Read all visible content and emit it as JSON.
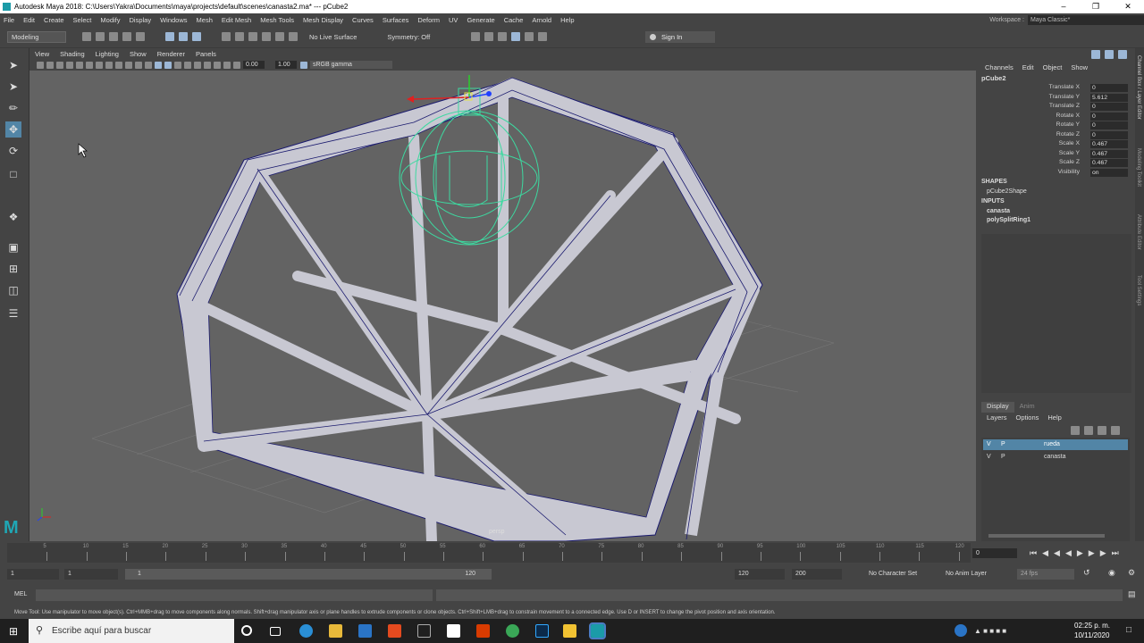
{
  "window": {
    "title": "Autodesk Maya 2018: C:\\Users\\Yakra\\Documents\\maya\\projects\\default\\scenes\\canasta2.ma*   ---   pCube2",
    "workspace_label": "Workspace :",
    "workspace_value": "Maya Classic*"
  },
  "menu": [
    "File",
    "Edit",
    "Create",
    "Select",
    "Modify",
    "Display",
    "Windows",
    "Mesh",
    "Edit Mesh",
    "Mesh Tools",
    "Mesh Display",
    "Curves",
    "Surfaces",
    "Deform",
    "UV",
    "Generate",
    "Cache",
    "Arnold",
    "Help"
  ],
  "shelf": {
    "mode": "Modeling",
    "live_surface": "No Live Surface",
    "symmetry": "Symmetry: Off",
    "sign_in": "Sign In"
  },
  "viewport": {
    "menu": [
      "View",
      "Shading",
      "Lighting",
      "Show",
      "Renderer",
      "Panels"
    ],
    "exposure": "0.00",
    "gamma": "1.00",
    "colorspace": "sRGB gamma",
    "camera_label": "persp"
  },
  "channel_box": {
    "tabs": [
      "Channels",
      "Edit",
      "Object",
      "Show"
    ],
    "object": "pCube2",
    "attributes": [
      {
        "label": "Translate X",
        "value": "0"
      },
      {
        "label": "Translate Y",
        "value": "5.612"
      },
      {
        "label": "Translate Z",
        "value": "0"
      },
      {
        "label": "Rotate X",
        "value": "0"
      },
      {
        "label": "Rotate Y",
        "value": "0"
      },
      {
        "label": "Rotate Z",
        "value": "0"
      },
      {
        "label": "Scale X",
        "value": "0.467"
      },
      {
        "label": "Scale Y",
        "value": "0.467"
      },
      {
        "label": "Scale Z",
        "value": "0.467"
      },
      {
        "label": "Visibility",
        "value": "on"
      }
    ],
    "shapes_header": "SHAPES",
    "shape": "pCube2Shape",
    "inputs_header": "INPUTS",
    "inputs": [
      "canasta",
      "polySplitRing1"
    ]
  },
  "layer_editor": {
    "tabs": [
      "Display",
      "Anim"
    ],
    "menu": [
      "Layers",
      "Options",
      "Help"
    ],
    "layers": [
      {
        "v": "V",
        "p": "P",
        "name": "rueda",
        "selected": true
      },
      {
        "v": "V",
        "p": "P",
        "name": "canasta",
        "selected": false
      }
    ]
  },
  "side_tabs": [
    "Channel Box / Layer Editor",
    "Modeling Toolkit",
    "Attribute Editor",
    "Tool Settings"
  ],
  "timeline": {
    "ticks": [
      "5",
      "10",
      "15",
      "20",
      "25",
      "30",
      "35",
      "40",
      "45",
      "50",
      "55",
      "60",
      "65",
      "70",
      "75",
      "80",
      "85",
      "90",
      "95",
      "100",
      "105",
      "110",
      "115",
      "120"
    ],
    "current_frame": "0"
  },
  "range": {
    "start": "1",
    "start2": "1",
    "slider_start": "1",
    "slider_end": "120",
    "end": "120",
    "end2": "200",
    "char_set": "No Character Set",
    "anim_layer": "No Anim Layer",
    "fps": "24 fps"
  },
  "command": {
    "lang": "MEL"
  },
  "help_line": "Move Tool: Use manipulator to move object(s). Ctrl+MMB+drag to move components along normals. Shift+drag manipulator axis or plane handles to extrude components or clone objects. Ctrl+Shift+LMB+drag to constrain movement to a connected edge. Use D or INSERT to change the pivot position and axis orientation.",
  "taskbar": {
    "search_placeholder": "Escribe aquí para buscar",
    "time": "02:25 p. m.",
    "date": "10/11/2020"
  }
}
